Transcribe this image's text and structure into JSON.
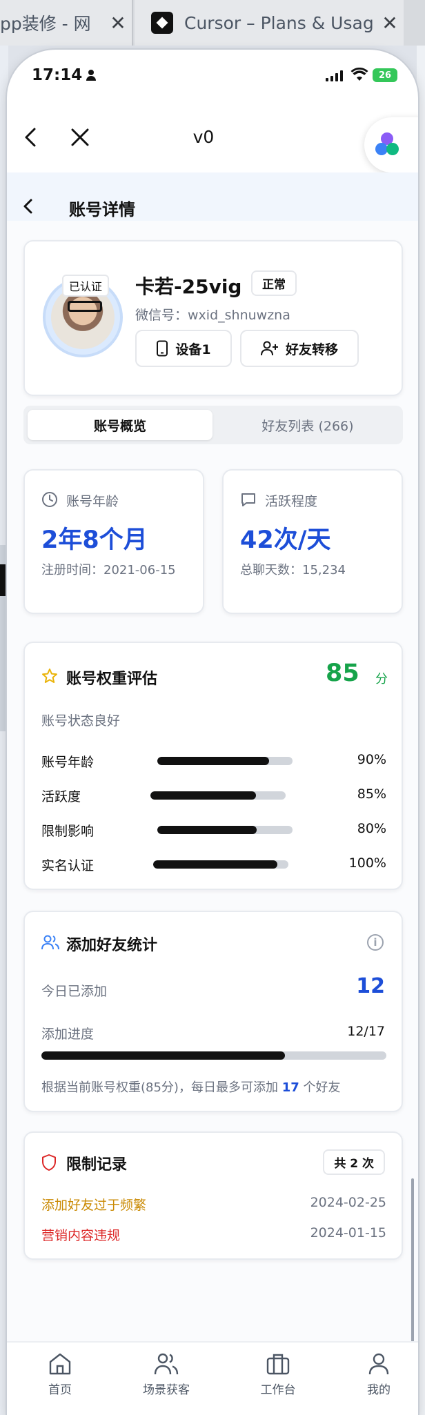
{
  "browser": {
    "tabs": [
      {
        "title": "pp装修 - 网",
        "close": "✕"
      },
      {
        "title": "Cursor – Plans & Usag",
        "close": "✕"
      }
    ]
  },
  "status_bar": {
    "time": "17:14",
    "battery": "26"
  },
  "nav": {
    "title": "v0"
  },
  "page": {
    "title": "账号详情"
  },
  "profile": {
    "verified_badge": "已认证",
    "name": "卡若-25vig",
    "status": "正常",
    "wechat_id": "微信号：wxid_shnuwzna",
    "device_button": "设备1",
    "transfer_button": "好友转移"
  },
  "tabs": {
    "overview": "账号概览",
    "friends": "好友列表 (266)"
  },
  "stats": {
    "age": {
      "label": "账号年龄",
      "value": "2年8个月",
      "sub": "注册时间：2021-06-15"
    },
    "activity": {
      "label": "活跃程度",
      "value": "42次/天",
      "sub": "总聊天数：15,234"
    }
  },
  "weight": {
    "title": "账号权重评估",
    "score": "85",
    "unit": "分",
    "state": "账号状态良好",
    "rows": [
      {
        "label": "账号年龄",
        "value": "90%",
        "pct": 90
      },
      {
        "label": "活跃度",
        "value": "85%",
        "pct": 85
      },
      {
        "label": "限制影响",
        "value": "80%",
        "pct": 80
      },
      {
        "label": "实名认证",
        "value": "100%",
        "pct": 100
      }
    ]
  },
  "friends": {
    "title": "添加好友统计",
    "today_label": "今日已添加",
    "today_value": "12",
    "progress_label": "添加进度",
    "progress_value": "12/17",
    "progress_fraction": 0.706,
    "note_prefix": "根据当前账号权重(85分)，每日最多可添加",
    "note_limit": "17",
    "note_suffix": "个好友"
  },
  "restrictions": {
    "title": "限制记录",
    "count": "共 2 次",
    "items": [
      {
        "name": "添加好友过于频繁",
        "date": "2024-02-25",
        "color": "#ca8a04"
      },
      {
        "name": "营销内容违规",
        "date": "2024-01-15",
        "color": "#dc2626"
      }
    ]
  },
  "tabbar": {
    "home": "首页",
    "scenes": "场景获客",
    "workbench": "工作台",
    "mine": "我的"
  },
  "colors": {
    "accent": "#1d4ed8",
    "score": "#16a34a"
  }
}
